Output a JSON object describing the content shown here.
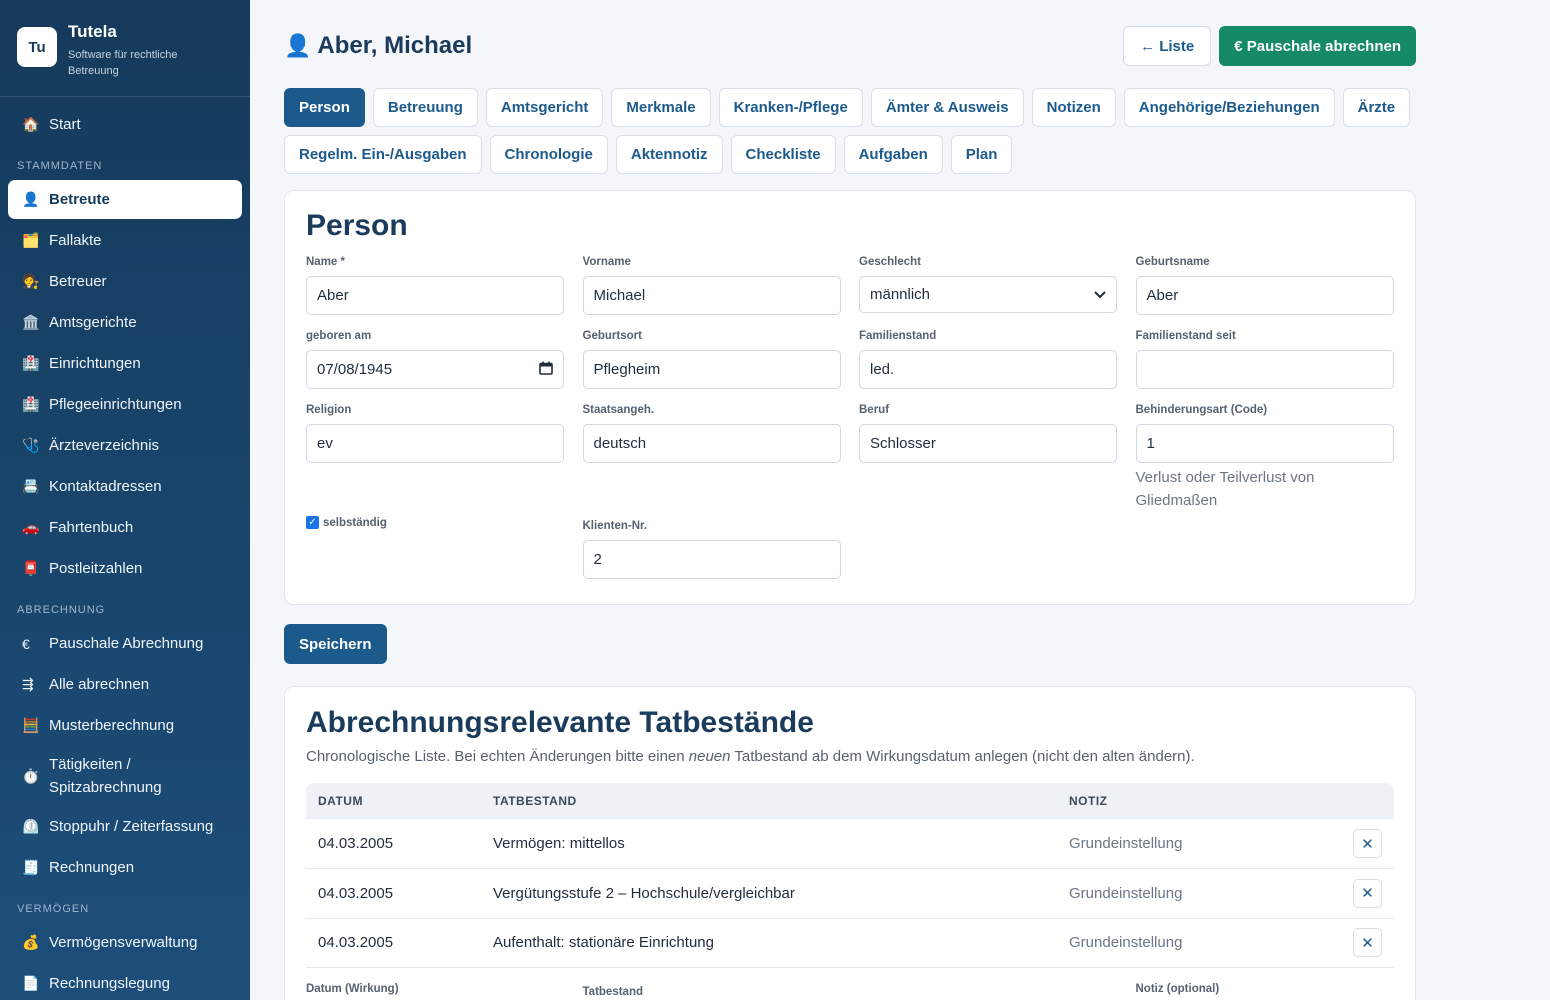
{
  "brand": {
    "logo": "Tu",
    "title": "Tutela",
    "subtitle": "Software für rechtliche Betreuung"
  },
  "sidebar": {
    "start": {
      "icon": "🏠",
      "label": "Start"
    },
    "sections": {
      "stammdaten": "Stammdaten",
      "abrechnung": "Abrechnung",
      "vermoegen": "Vermögen"
    },
    "stammdaten_items": [
      {
        "icon": "👤",
        "label": "Betreute"
      },
      {
        "icon": "🗂️",
        "label": "Fallakte"
      },
      {
        "icon": "🧑‍⚖️",
        "label": "Betreuer"
      },
      {
        "icon": "🏛️",
        "label": "Amtsgerichte"
      },
      {
        "icon": "🏥",
        "label": "Einrichtungen"
      },
      {
        "icon": "🏥",
        "label": "Pflegeeinrichtungen"
      },
      {
        "icon": "🩺",
        "label": "Ärzteverzeichnis"
      },
      {
        "icon": "📇",
        "label": "Kontaktadressen"
      },
      {
        "icon": "🚗",
        "label": "Fahrtenbuch"
      },
      {
        "icon": "📮",
        "label": "Postleitzahlen"
      }
    ],
    "abrechnung_items": [
      {
        "icon": "€",
        "label": "Pauschale Abrechnung"
      },
      {
        "icon": "⇶",
        "label": "Alle abrechnen"
      },
      {
        "icon": "🧮",
        "label": "Musterberechnung"
      },
      {
        "icon": "⏱️",
        "label": "Tätigkeiten / Spitzabrechnung"
      },
      {
        "icon": "⏲️",
        "label": "Stoppuhr / Zeiterfassung"
      },
      {
        "icon": "🧾",
        "label": "Rechnungen"
      }
    ],
    "vermoegen_items": [
      {
        "icon": "💰",
        "label": "Vermögensverwaltung"
      },
      {
        "icon": "📄",
        "label": "Rechnungslegung"
      }
    ]
  },
  "header": {
    "icon": "👤",
    "title": "Aber, Michael",
    "list_button": "← Liste",
    "pauschale_button": "€ Pauschale abrechnen"
  },
  "tabs": [
    "Person",
    "Betreuung",
    "Amtsgericht",
    "Merkmale",
    "Kranken-/Pflege",
    "Ämter & Ausweis",
    "Notizen",
    "Angehörige/Beziehungen",
    "Ärzte",
    "Regelm. Ein-/Ausgaben",
    "Chronologie",
    "Aktennotiz",
    "Checkliste",
    "Aufgaben",
    "Plan"
  ],
  "person": {
    "title": "Person",
    "name_label": "Name *",
    "name": "Aber",
    "vorname_label": "Vorname",
    "vorname": "Michael",
    "geschlecht_label": "Geschlecht",
    "geschlecht": "männlich",
    "geburtsname_label": "Geburtsname",
    "geburtsname": "Aber",
    "geboren_label": "geboren am",
    "geboren": "07/08/1945",
    "geburtsort_label": "Geburtsort",
    "geburtsort": "Pflegheim",
    "familienstand_label": "Familienstand",
    "familienstand": "led.",
    "familienstand_seit_label": "Familienstand seit",
    "familienstand_seit": "",
    "religion_label": "Religion",
    "religion": "ev",
    "staatsangeh_label": "Staatsangeh.",
    "staatsangeh": "deutsch",
    "beruf_label": "Beruf",
    "beruf": "Schlosser",
    "behinderung_label": "Behinderungsart (Code)",
    "behinderung": "1",
    "behinderung_hint": "Verlust oder Teilverlust von Gliedmaßen",
    "selbstaendig_label": "selbständig",
    "klienten_label": "Klienten-Nr.",
    "klienten": "2"
  },
  "save_button": "Speichern",
  "tatbestaende": {
    "title": "Abrechnungsrelevante Tatbestände",
    "subtitle_before": "Chronologische Liste. Bei echten Änderungen bitte einen ",
    "subtitle_em": "neuen",
    "subtitle_after": " Tatbestand ab dem Wirkungsdatum anlegen (nicht den alten ändern).",
    "columns": [
      "Datum",
      "Tatbestand",
      "Notiz"
    ],
    "rows": [
      {
        "datum": "04.03.2005",
        "tatbestand": "Vermögen: mittellos",
        "notiz": "Grundeinstellung"
      },
      {
        "datum": "04.03.2005",
        "tatbestand": "Vergütungsstufe 2 – Hochschule/vergleichbar",
        "notiz": "Grundeinstellung"
      },
      {
        "datum": "04.03.2005",
        "tatbestand": "Aufenthalt: stationäre Einrichtung",
        "notiz": "Grundeinstellung"
      }
    ],
    "delete_label": "✕",
    "new_datum_label": "Datum (Wirkung)",
    "new_tatbestand_label": "Tatbestand",
    "new_notiz_label": "Notiz (optional)"
  }
}
